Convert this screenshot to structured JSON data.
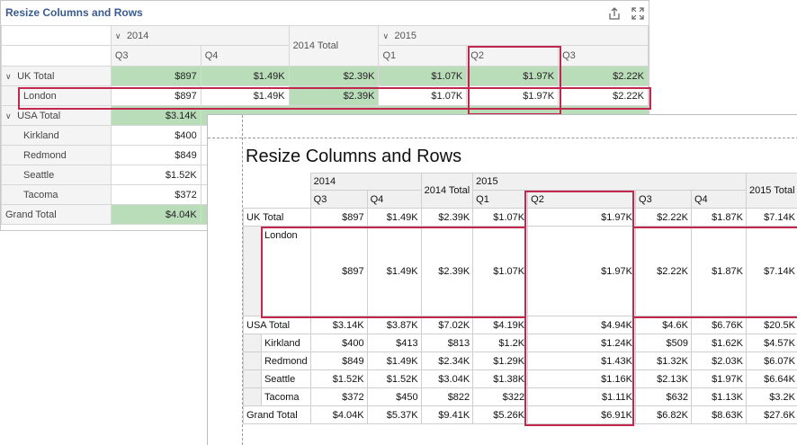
{
  "card": {
    "title": "Resize Columns and Rows",
    "col_headers": {
      "y2014": "2014",
      "y2014_total": "2014 Total",
      "y2015": "2015",
      "q3": "Q3",
      "q4": "Q4",
      "q1": "Q1",
      "q2": "Q2",
      "q3b": "Q3"
    },
    "rows": [
      {
        "label": "UK Total",
        "values": [
          "$897",
          "$1.49K",
          "$2.39K",
          "$1.07K",
          "$1.97K",
          "$2.22K"
        ]
      },
      {
        "label": "London",
        "values": [
          "$897",
          "$1.49K",
          "$2.39K",
          "$1.07K",
          "$1.97K",
          "$2.22K"
        ]
      },
      {
        "label": "USA Total",
        "values": [
          "$3.14K"
        ]
      },
      {
        "label": "Kirkland",
        "values": [
          "$400"
        ]
      },
      {
        "label": "Redmond",
        "values": [
          "$849"
        ]
      },
      {
        "label": "Seattle",
        "values": [
          "$1.52K"
        ]
      },
      {
        "label": "Tacoma",
        "values": [
          "$372"
        ]
      },
      {
        "label": "Grand Total",
        "values": [
          "$4.04K"
        ]
      }
    ]
  },
  "preview": {
    "title": "Resize Columns and Rows",
    "headers": {
      "y2014": "2014",
      "y2014_total": "2014 Total",
      "y2015": "2015",
      "y2015_total": "2015 Total",
      "q3": "Q3",
      "q4": "Q4",
      "q1": "Q1",
      "q2": "Q2",
      "q3b": "Q3",
      "q4b": "Q4"
    },
    "rows": [
      {
        "label": "UK Total",
        "values": [
          "$897",
          "$1.49K",
          "$2.39K",
          "$1.07K",
          "$1.97K",
          "$2.22K",
          "$1.87K",
          "$7.14K"
        ]
      },
      {
        "label": "London",
        "values": [
          "$897",
          "$1.49K",
          "$2.39K",
          "$1.07K",
          "$1.97K",
          "$2.22K",
          "$1.87K",
          "$7.14K"
        ]
      },
      {
        "label": "USA Total",
        "values": [
          "$3.14K",
          "$3.87K",
          "$7.02K",
          "$4.19K",
          "$4.94K",
          "$4.6K",
          "$6.76K",
          "$20.5K"
        ]
      },
      {
        "label": "Kirkland",
        "values": [
          "$400",
          "$413",
          "$813",
          "$1.2K",
          "$1.24K",
          "$509",
          "$1.62K",
          "$4.57K"
        ]
      },
      {
        "label": "Redmond",
        "values": [
          "$849",
          "$1.49K",
          "$2.34K",
          "$1.29K",
          "$1.43K",
          "$1.32K",
          "$2.03K",
          "$6.07K"
        ]
      },
      {
        "label": "Seattle",
        "values": [
          "$1.52K",
          "$1.52K",
          "$3.04K",
          "$1.38K",
          "$1.16K",
          "$2.13K",
          "$1.97K",
          "$6.64K"
        ]
      },
      {
        "label": "Tacoma",
        "values": [
          "$372",
          "$450",
          "$822",
          "$322",
          "$1.11K",
          "$632",
          "$1.13K",
          "$3.2K"
        ]
      },
      {
        "label": "Grand Total",
        "values": [
          "$4.04K",
          "$5.37K",
          "$9.41K",
          "$5.26K",
          "$6.91K",
          "$6.82K",
          "$8.63K",
          "$27.6K"
        ]
      }
    ]
  },
  "icons": {
    "export": "export-icon",
    "maximize": "maximize-icon"
  },
  "colors": {
    "highlight": "#c2284d",
    "green_cell": "#b9dcb9",
    "title_blue": "#3a5b8f"
  }
}
